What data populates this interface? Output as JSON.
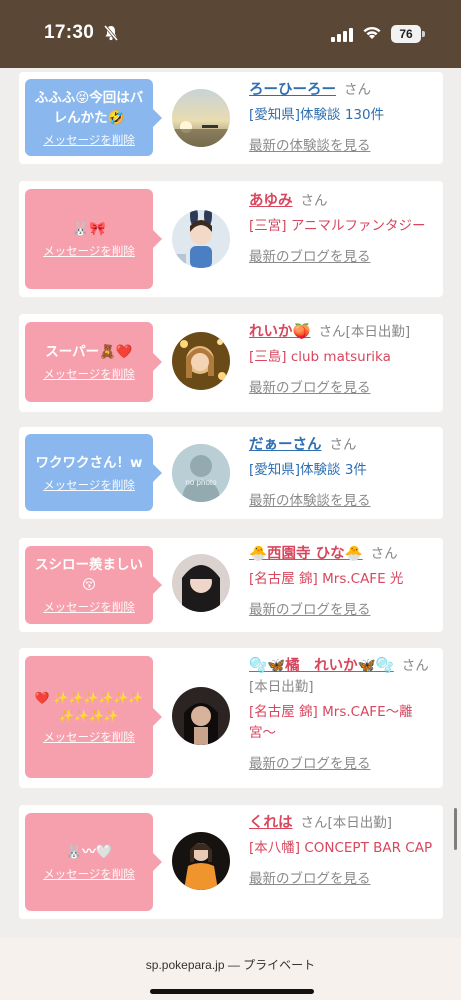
{
  "status_bar": {
    "time": "17:30",
    "battery": "76"
  },
  "cards": [
    {
      "bubble_color": "blue",
      "message": "ふふふ😝今回はバレんかた🤣",
      "delete": "メッセージを削除",
      "name": "ろーひーろー",
      "san": "さん",
      "sub": "[愛知県]体験談 130件",
      "more": "最新の体験談を見る",
      "theme": "blue",
      "avatar_type": "sunset"
    },
    {
      "bubble_color": "pink",
      "message": "🐰🎀",
      "delete": "メッセージを削除",
      "name": "あゆみ",
      "san": "さん",
      "sub": "[三宮] アニマルファンタジー",
      "more": "最新のブログを見る",
      "theme": "pink",
      "avatar_type": "bunny"
    },
    {
      "bubble_color": "pink",
      "message": "スーパー🧸❤️",
      "delete": "メッセージを削除",
      "name": "れいか🍑",
      "san": "さん[本日出勤]",
      "sub": "[三島] club matsurika",
      "more": "最新のブログを見る",
      "theme": "pink",
      "avatar_type": "gold"
    },
    {
      "bubble_color": "blue",
      "message": "ワクワクさん！w",
      "delete": "メッセージを削除",
      "name": "だぁーさん",
      "san": "さん",
      "sub": "[愛知県]体験談 3件",
      "more": "最新の体験談を見る",
      "theme": "blue",
      "avatar_type": "nophoto",
      "avatar_text": "no photo"
    },
    {
      "bubble_color": "pink",
      "message": "スシロー羨ましい😚",
      "delete": "メッセージを削除",
      "name": "🐣西園寺 ひな🐣",
      "san": "さん",
      "sub": "[名古屋 錦] Mrs.CAFE 光",
      "more": "最新のブログを見る",
      "theme": "pink",
      "avatar_type": "darkhair"
    },
    {
      "bubble_color": "pink",
      "message": "❤️ ✨✨✨✨✨✨ ✨✨✨✨",
      "delete": "メッセージを削除",
      "name": "🫧🦋橘　れいか🦋🫧",
      "san": "さん[本日出勤]",
      "sub": "[名古屋 錦] Mrs.CAFE〜離宮〜",
      "more": "最新のブログを見る",
      "theme": "pink",
      "avatar_type": "dark"
    },
    {
      "bubble_color": "pink",
      "message": "🐰〰🤍",
      "delete": "メッセージを削除",
      "name": "くれは",
      "san": "さん[本日出勤]",
      "sub": "[本八幡] CONCEPT BAR CAP",
      "more": "最新のブログを見る",
      "theme": "pink",
      "avatar_type": "orange"
    }
  ],
  "bottom_bar": {
    "url": "sp.pokepara.jp — プライベート"
  }
}
